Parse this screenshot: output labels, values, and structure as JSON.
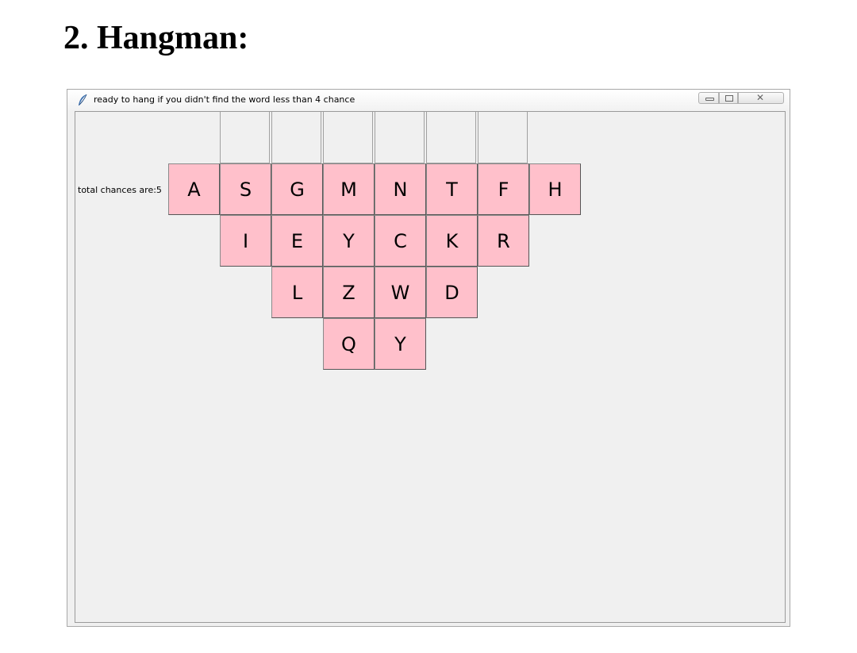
{
  "document": {
    "heading": "2. Hangman:"
  },
  "window": {
    "title": "ready to hang if you didn't find the word less than 4 chance",
    "icon": "feather-icon",
    "controls": [
      "minimize",
      "maximize",
      "close"
    ]
  },
  "game": {
    "chances_label": "total chances are:5",
    "word_slots": 6,
    "button_color": "#ffc0cb",
    "rows": [
      [
        "A",
        "S",
        "G",
        "M",
        "N",
        "T",
        "F",
        "H"
      ],
      [
        "I",
        "E",
        "Y",
        "C",
        "K",
        "R"
      ],
      [
        "L",
        "Z",
        "W",
        "D"
      ],
      [
        "Q",
        "Y"
      ]
    ]
  }
}
